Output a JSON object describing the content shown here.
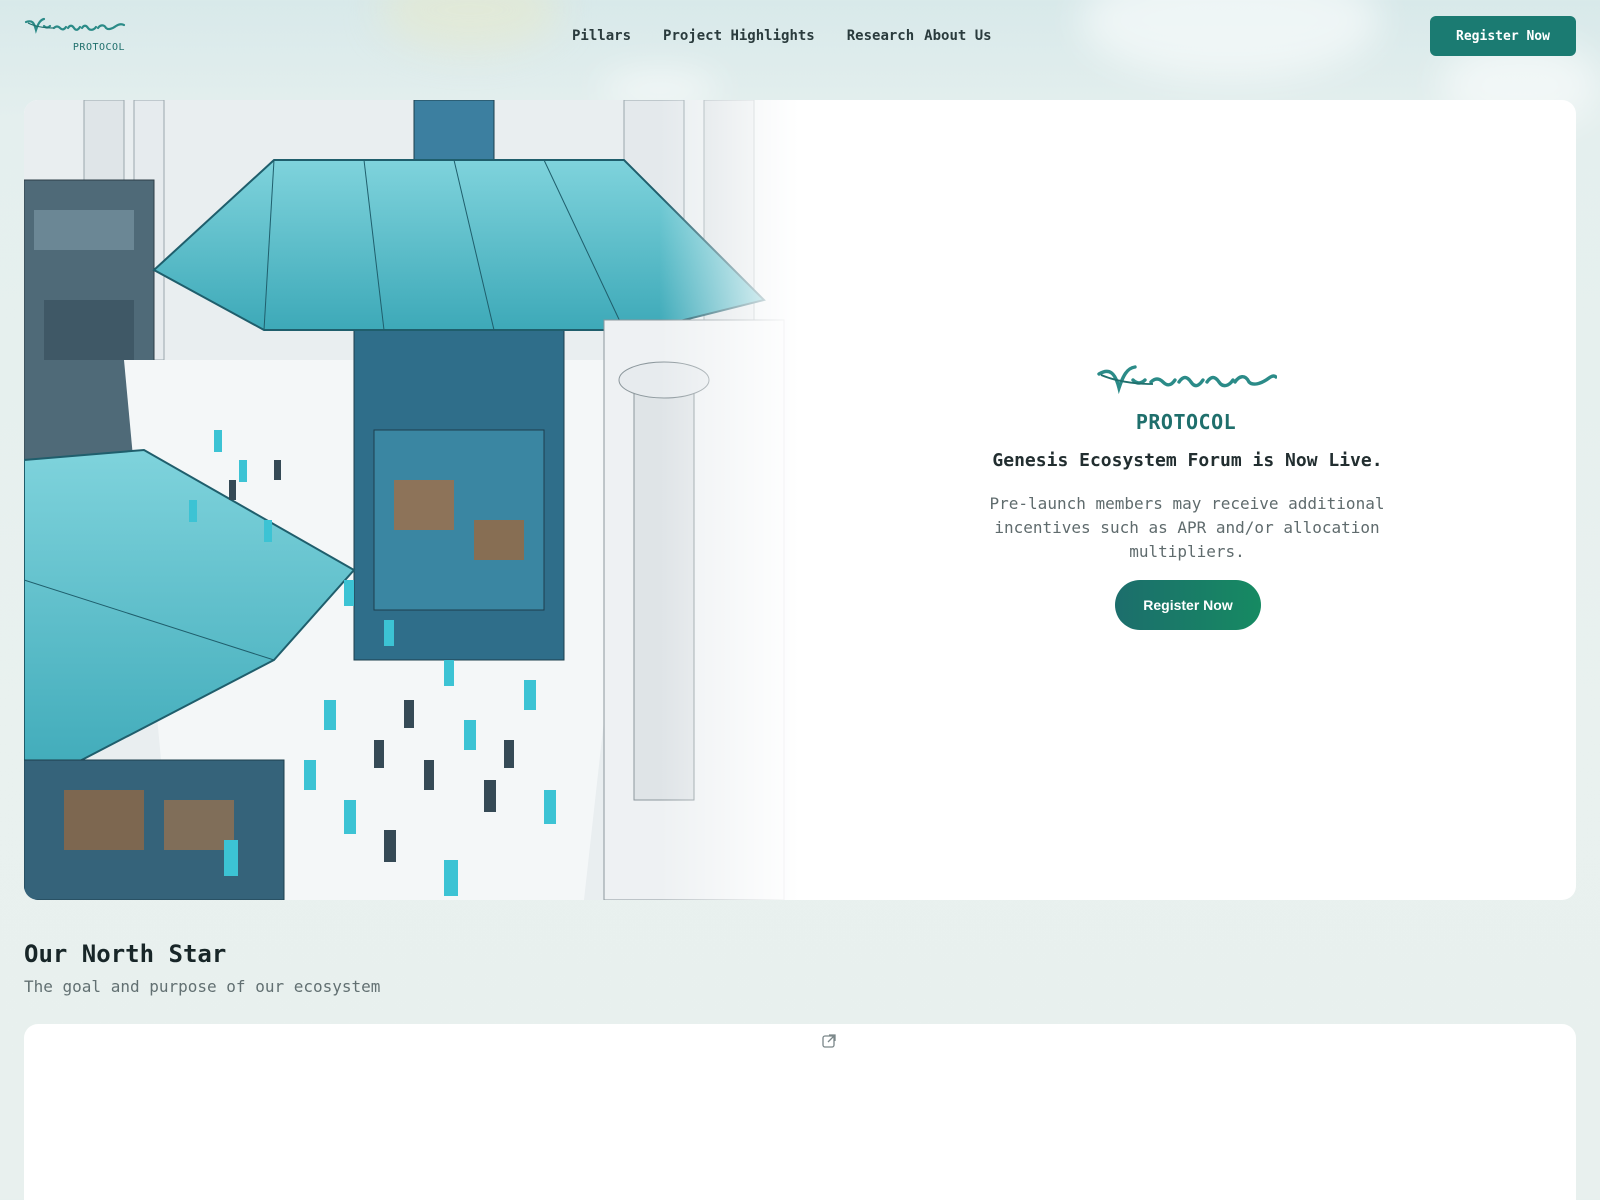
{
  "brand": {
    "script_name": "Virtual",
    "subtitle": "PROTOCOL",
    "primary_color": "#1b7b72",
    "gradient_end": "#168a62"
  },
  "nav": {
    "items": [
      {
        "label": "Pillars"
      },
      {
        "label": "Project Highlights"
      },
      {
        "label": "Research"
      },
      {
        "label": "About Us"
      }
    ],
    "register_label": "Register Now"
  },
  "hero": {
    "image_alt": "futuristic marketplace illustration",
    "title": "Genesis Ecosystem Forum is Now Live.",
    "text": "Pre-launch members may receive additional incentives such as APR and/or allocation multipliers.",
    "cta_label": "Register Now"
  },
  "north_star": {
    "title": "Our North Star",
    "subtitle": "The goal and purpose of our ecosystem",
    "embed_icon": "external-link-icon"
  }
}
